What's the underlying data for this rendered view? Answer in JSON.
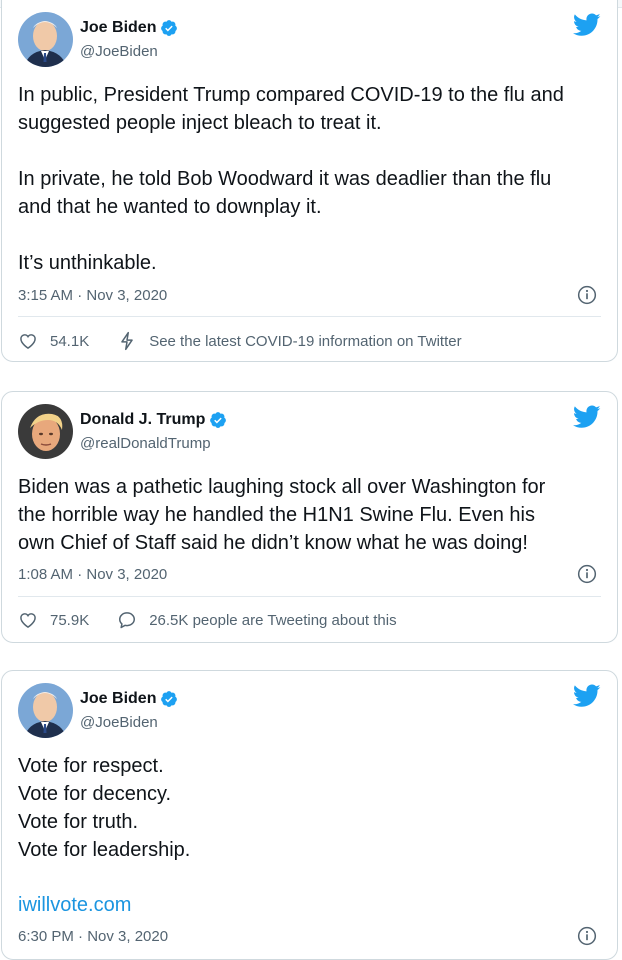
{
  "tweets": [
    {
      "name": "Joe Biden",
      "handle": "@JoeBiden",
      "text": "In public, President Trump compared COVID-19 to the flu and\nsuggested people inject bleach to treat it.\n\nIn private, he told Bob Woodward it was deadlier than the flu\nand that he wanted to downplay it.\n\nIt’s unthinkable.",
      "timestamp": "3:15 AM · Nov 3, 2020",
      "likes": "54.1K",
      "secondary": "See the latest COVID-19 information on Twitter"
    },
    {
      "name": "Donald J. Trump",
      "handle": "@realDonaldTrump",
      "text": "Biden was a pathetic laughing stock all over Washington for\nthe horrible way he handled the H1N1 Swine Flu. Even his\nown Chief of Staff said he didn’t know what he was doing!",
      "timestamp": "1:08 AM · Nov 3, 2020",
      "likes": "75.9K",
      "secondary": "26.5K people are Tweeting about this"
    },
    {
      "name": "Joe Biden",
      "handle": "@JoeBiden",
      "text": "Vote for respect.\nVote for decency.\nVote for truth.\nVote for leadership.",
      "link": "iwillvote.com",
      "timestamp": "6:30 PM · Nov 3, 2020"
    }
  ],
  "colors": {
    "twitter_blue": "#1da1f2",
    "link": "#1b95e0",
    "muted": "#536471",
    "border": "#cfd9de"
  },
  "icons": [
    "twitter-bird-icon",
    "verified-badge-icon",
    "info-icon",
    "heart-icon",
    "lightning-icon",
    "chat-bubble-icon"
  ]
}
